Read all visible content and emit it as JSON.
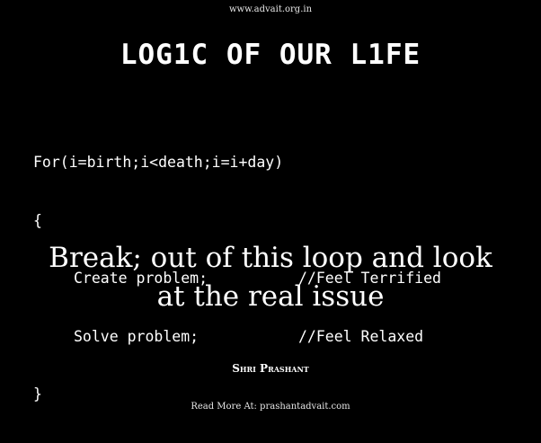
{
  "header": {
    "site_url": "www.advait.org.in"
  },
  "title": "LOG1C OF OUR L1FE",
  "code": {
    "loop_header": "For(i=birth;i<death;i=i+day)",
    "open_brace": "{",
    "statements": [
      {
        "statement": "Create problem;",
        "comment": "//Feel Terrified"
      },
      {
        "statement": "Solve problem;",
        "comment": "//Feel Relaxed"
      }
    ],
    "close_brace": "}"
  },
  "quote": {
    "line1": "Break; out of this loop and look",
    "line2": "at the real issue"
  },
  "author": "Shri Prashant",
  "footer": {
    "read_more": "Read More At: prashantadvait.com"
  },
  "colors": {
    "background": "#000000",
    "text": "#ffffff"
  }
}
